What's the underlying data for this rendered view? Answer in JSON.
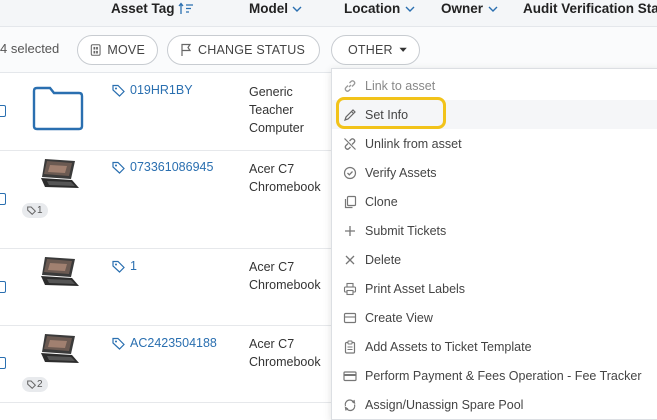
{
  "header": {
    "asset_tag": "Asset Tag",
    "model": "Model",
    "location": "Location",
    "owner": "Owner",
    "audit": "Audit Verification Sta"
  },
  "toolbar": {
    "selected_text": "4 selected",
    "move": "MOVE",
    "change_status": "CHANGE STATUS",
    "other": "OTHER"
  },
  "rows": [
    {
      "asset_tag": "019HR1BY",
      "model": "Generic Teacher Computer",
      "image": "folder-icon",
      "ticket_count": ""
    },
    {
      "asset_tag": "073361086945",
      "model": "Acer C7 Chromebook",
      "image": "laptop-image",
      "ticket_count": "1"
    },
    {
      "asset_tag": "1",
      "model": "Acer C7 Chromebook",
      "image": "laptop-image",
      "ticket_count": ""
    },
    {
      "asset_tag": "AC2423504188",
      "model": "Acer C7 Chromebook",
      "image": "laptop-image",
      "ticket_count": "2"
    }
  ],
  "menu": {
    "items": [
      {
        "label": "Link to asset",
        "icon": "link-icon",
        "disabled": true
      },
      {
        "label": "Set Info",
        "icon": "pencil-icon",
        "disabled": false
      },
      {
        "label": "Unlink from asset",
        "icon": "unlink-icon",
        "disabled": false
      },
      {
        "label": "Verify Assets",
        "icon": "verify-icon",
        "disabled": false
      },
      {
        "label": "Clone",
        "icon": "clone-icon",
        "disabled": false
      },
      {
        "label": "Submit Tickets",
        "icon": "plus-icon",
        "disabled": false
      },
      {
        "label": "Delete",
        "icon": "close-icon",
        "disabled": false
      },
      {
        "label": "Print Asset Labels",
        "icon": "printer-icon",
        "disabled": false
      },
      {
        "label": "Create View",
        "icon": "view-icon",
        "disabled": false
      },
      {
        "label": "Add Assets to Ticket Template",
        "icon": "clipboard-icon",
        "disabled": false
      },
      {
        "label": "Perform Payment & Fees Operation - Fee Tracker",
        "icon": "payment-icon",
        "disabled": false
      },
      {
        "label": "Assign/Unassign Spare Pool",
        "icon": "swap-icon",
        "disabled": false
      }
    ]
  },
  "colors": {
    "link": "#2a6fb0",
    "highlight": "#f2c31a",
    "folder": "#2a6fb0"
  }
}
